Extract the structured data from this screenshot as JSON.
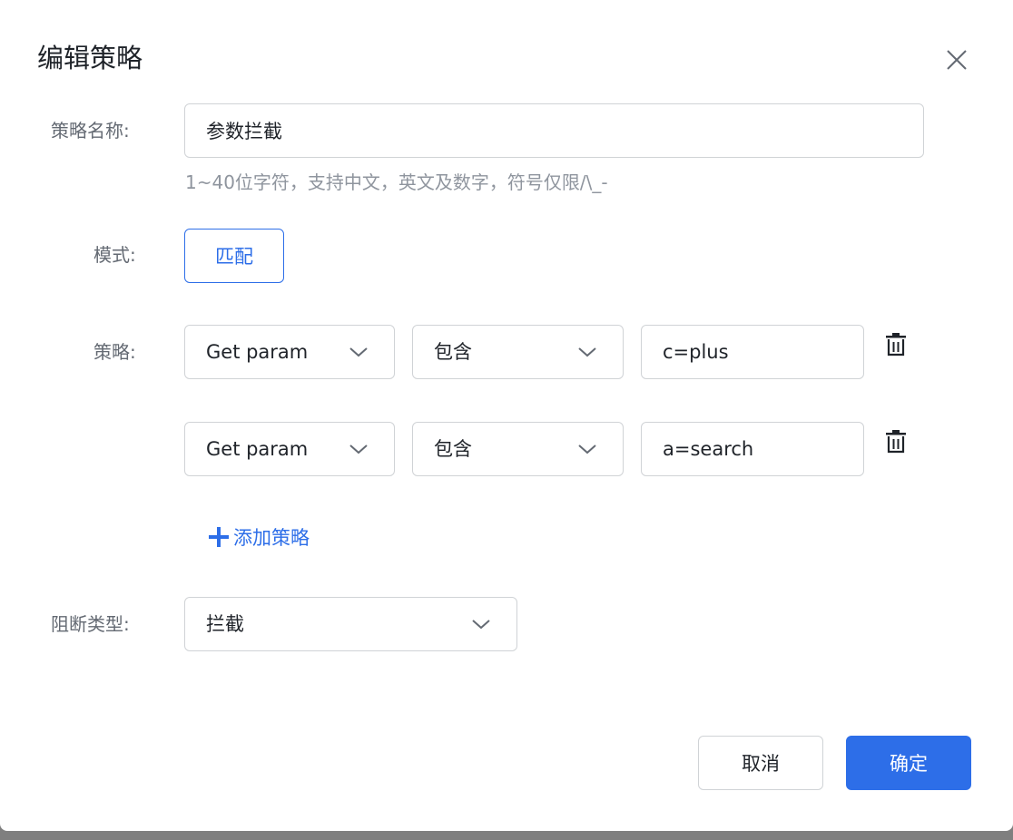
{
  "dialog": {
    "title": "编辑策略",
    "close_icon": "close-icon"
  },
  "form": {
    "name": {
      "label": "策略名称:",
      "value": "参数拦截",
      "hint": "1~40位字符，支持中文，英文及数字，符号仅限/\\_-"
    },
    "mode": {
      "label": "模式:",
      "button_label": "匹配"
    },
    "policy": {
      "label": "策略:",
      "rules": [
        {
          "field": "Get param",
          "operator": "包含",
          "value": "c=plus"
        },
        {
          "field": "Get param",
          "operator": "包含",
          "value": "a=search"
        }
      ],
      "add_label": "添加策略"
    },
    "block_type": {
      "label": "阻断类型:",
      "value": "拦截"
    }
  },
  "footer": {
    "cancel_label": "取消",
    "ok_label": "确定"
  },
  "colors": {
    "accent": "#2d6ee8",
    "border": "#d0d3d6",
    "label_text": "#646a73",
    "hint_text": "#8f959e"
  }
}
